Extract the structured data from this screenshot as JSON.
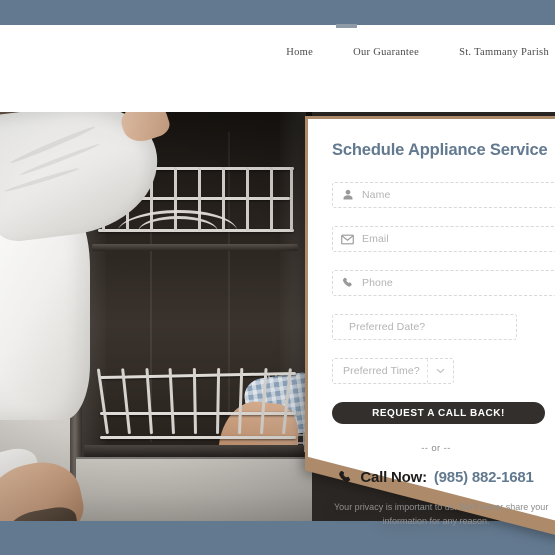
{
  "theme": {
    "slate": "#63798f",
    "bronze": "#ac8a6a",
    "button_dark": "#332f2d",
    "card_white": "#ffffff",
    "placeholder_grey": "#b3b3b3"
  },
  "nav": {
    "items": [
      {
        "label": "Home"
      },
      {
        "label": "Our Guarantee"
      },
      {
        "label": "St. Tammany Parish"
      }
    ]
  },
  "hero": {
    "alt": "Technician opening a dishwasher with racks pulled out"
  },
  "form": {
    "title": "Schedule Appliance Service",
    "fields": [
      {
        "name": "name",
        "icon": "user-icon",
        "placeholder": "Name",
        "value": ""
      },
      {
        "name": "email",
        "icon": "envelope-icon",
        "placeholder": "Email",
        "value": ""
      },
      {
        "name": "phone",
        "icon": "phone-icon",
        "placeholder": "Phone",
        "value": ""
      }
    ],
    "date_placeholder": "Preferred Date?",
    "date_value": "",
    "time_placeholder": "Preferred Time?",
    "time_value": "",
    "time_caret_icon": "chevron-down-icon",
    "submit_label": "REQUEST A CALL BACK!"
  },
  "cta": {
    "or_text": "-- or --",
    "call_icon": "phone-icon",
    "call_label": "Call Now:",
    "call_number": "(985) 882-1681",
    "privacy_line1": "Your privacy is important to us. We'll never share your",
    "privacy_line2": "information for any reason."
  }
}
